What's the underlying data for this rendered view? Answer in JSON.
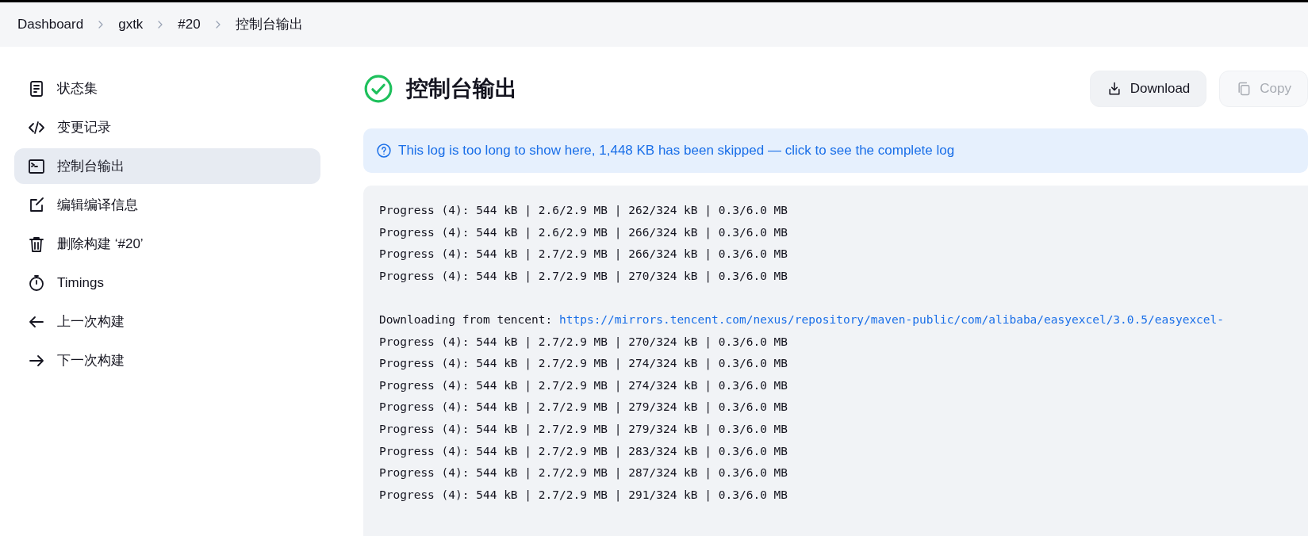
{
  "breadcrumb": [
    {
      "label": "Dashboard"
    },
    {
      "label": "gxtk"
    },
    {
      "label": "#20"
    },
    {
      "label": "控制台输出"
    }
  ],
  "sidebar": {
    "items": [
      {
        "kind": "document",
        "label": "状态集",
        "selected": false
      },
      {
        "kind": "code",
        "label": "变更记录",
        "selected": false
      },
      {
        "kind": "terminal",
        "label": "控制台输出",
        "selected": true
      },
      {
        "kind": "edit",
        "label": "编辑编译信息",
        "selected": false
      },
      {
        "kind": "trash",
        "label": "删除构建 ‘#20’",
        "selected": false
      },
      {
        "kind": "timer",
        "label": "Timings",
        "selected": false
      },
      {
        "kind": "left",
        "label": "上一次构建",
        "selected": false
      },
      {
        "kind": "right",
        "label": "下一次构建",
        "selected": false
      }
    ]
  },
  "header": {
    "title": "控制台输出",
    "succeeded": true,
    "buttons": [
      {
        "label": "Download",
        "kind": "download",
        "disabled": false
      },
      {
        "label": "Copy",
        "kind": "copy",
        "disabled": true
      }
    ]
  },
  "notice": {
    "text": "This log is too long to show here, 1,448 KB has been skipped — click to see the complete log"
  },
  "log": [
    {
      "kind": "text",
      "text": "Progress (4): 544 kB | 2.6/2.9 MB | 262/324 kB | 0.3/6.0 MB"
    },
    {
      "kind": "text",
      "text": "Progress (4): 544 kB | 2.6/2.9 MB | 266/324 kB | 0.3/6.0 MB"
    },
    {
      "kind": "text",
      "text": "Progress (4): 544 kB | 2.7/2.9 MB | 266/324 kB | 0.3/6.0 MB"
    },
    {
      "kind": "text",
      "text": "Progress (4): 544 kB | 2.7/2.9 MB | 270/324 kB | 0.3/6.0 MB"
    },
    {
      "kind": "blank"
    },
    {
      "kind": "link",
      "text": "Downloading from tencent:",
      "url": "https://mirrors.tencent.com/nexus/repository/maven-public/com/alibaba/easyexcel/3.0.5/easyexcel-"
    },
    {
      "kind": "text",
      "text": "Progress (4): 544 kB | 2.7/2.9 MB | 270/324 kB | 0.3/6.0 MB"
    },
    {
      "kind": "text",
      "text": "Progress (4): 544 kB | 2.7/2.9 MB | 274/324 kB | 0.3/6.0 MB"
    },
    {
      "kind": "text",
      "text": "Progress (4): 544 kB | 2.7/2.9 MB | 274/324 kB | 0.3/6.0 MB"
    },
    {
      "kind": "text",
      "text": "Progress (4): 544 kB | 2.7/2.9 MB | 279/324 kB | 0.3/6.0 MB"
    },
    {
      "kind": "text",
      "text": "Progress (4): 544 kB | 2.7/2.9 MB | 279/324 kB | 0.3/6.0 MB"
    },
    {
      "kind": "text",
      "text": "Progress (4): 544 kB | 2.7/2.9 MB | 283/324 kB | 0.3/6.0 MB"
    },
    {
      "kind": "text",
      "text": "Progress (4): 544 kB | 2.7/2.9 MB | 287/324 kB | 0.3/6.0 MB"
    },
    {
      "kind": "text",
      "text": "Progress (4): 544 kB | 2.7/2.9 MB | 291/324 kB | 0.3/6.0 MB"
    }
  ]
}
